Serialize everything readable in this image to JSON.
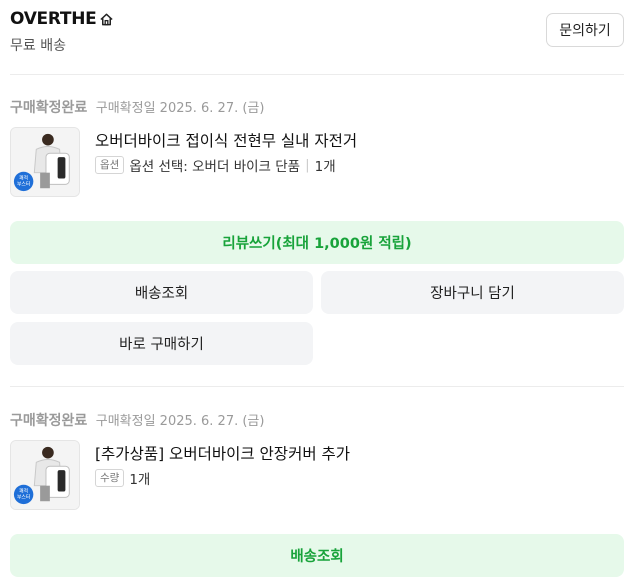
{
  "store": {
    "name": "OVERTHE",
    "shipping": "무료 배송",
    "inquiry_label": "문의하기"
  },
  "orders": [
    {
      "status": "구매확정완료",
      "date": "구매확정일 2025. 6. 27. (금)",
      "product_title": "오버더바이크 접이식 전현무 실내 자전거",
      "option_tag": "옵션",
      "option_value": "옵션 선택: 오버더 바이크 단품",
      "quantity": "1개",
      "badge": "쾌적 부스터",
      "review_label": "리뷰쓰기(최대 1,000원 적립)",
      "track_label": "배송조회",
      "cart_label": "장바구니 담기",
      "buy_again_label": "바로 구매하기"
    },
    {
      "status": "구매확정완료",
      "date": "구매확정일 2025. 6. 27. (금)",
      "product_title": "[추가상품] 오버더바이크 안장커버 추가",
      "option_tag": "수량",
      "quantity": "1개",
      "badge": "쾌적 부스터",
      "track_label": "배송조회"
    }
  ],
  "colors": {
    "green_bg": "#e6f9ea",
    "green_text": "#18a33a",
    "gray_bg": "#f3f4f6",
    "badge_blue": "#1f6fd8"
  }
}
